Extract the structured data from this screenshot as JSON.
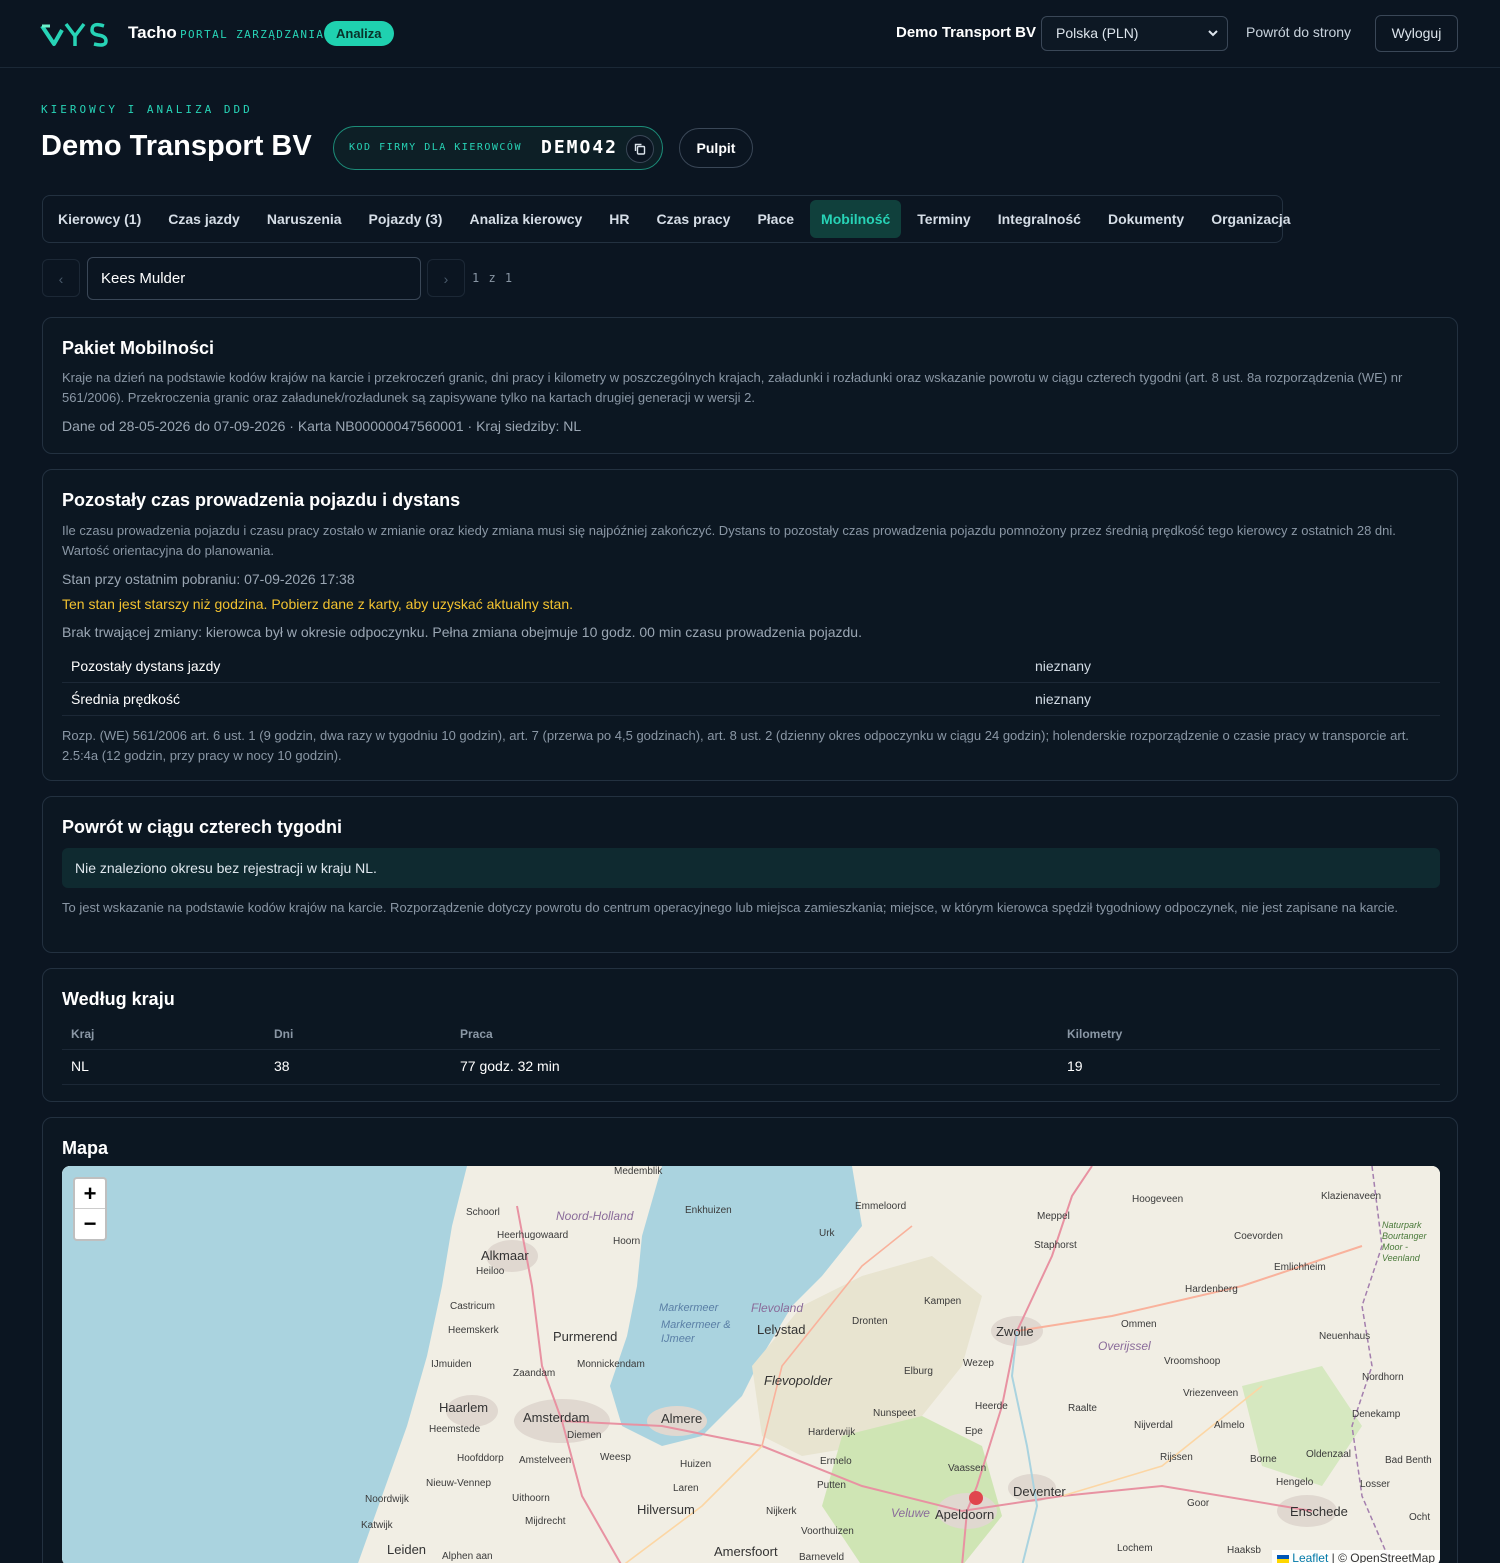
{
  "header": {
    "logo_text": "Tacho",
    "logo_sub": "PORTAL ZARZĄDZANIA",
    "badge": "Analiza",
    "company": "Demo Transport BV",
    "currency": "Polska (PLN)",
    "back_link": "Powrót do strony",
    "logout": "Wyloguj"
  },
  "page": {
    "eyebrow": "KIEROWCY I ANALIZA DDD",
    "title": "Demo Transport BV",
    "code_label": "KOD FIRMY DLA KIEROWCÓW",
    "code_value": "DEMO42",
    "pulpit": "Pulpit"
  },
  "tabs": [
    {
      "label": "Kierowcy (1)",
      "active": false
    },
    {
      "label": "Czas jazdy",
      "active": false
    },
    {
      "label": "Naruszenia",
      "active": false
    },
    {
      "label": "Pojazdy (3)",
      "active": false
    },
    {
      "label": "Analiza kierowcy",
      "active": false
    },
    {
      "label": "HR",
      "active": false
    },
    {
      "label": "Czas pracy",
      "active": false
    },
    {
      "label": "Płace",
      "active": false
    },
    {
      "label": "Mobilność",
      "active": true
    },
    {
      "label": "Terminy",
      "active": false
    },
    {
      "label": "Integralność",
      "active": false
    },
    {
      "label": "Dokumenty",
      "active": false
    },
    {
      "label": "Organizacja",
      "active": false
    }
  ],
  "driver": {
    "prev": "‹",
    "next": "›",
    "name": "Kees Mulder",
    "count": "1 z 1"
  },
  "pakiet": {
    "title": "Pakiet Mobilności",
    "desc": "Kraje na dzień na podstawie kodów krajów na karcie i przekroczeń granic, dni pracy i kilometry w poszczególnych krajach, załadunki i rozładunki oraz wskazanie powrotu w ciągu czterech tygodni (art. 8 ust. 8a rozporządzenia (WE) nr 561/2006). Przekroczenia granic oraz załadunek/rozładunek są zapisywane tylko na kartach drugiej generacji w wersji 2.",
    "meta": "Dane od 28-05-2026 do 07-09-2026 · Karta NB00000047560001 · Kraj siedziby: NL"
  },
  "remaining": {
    "title": "Pozostały czas prowadzenia pojazdu i dystans",
    "desc": "Ile czasu prowadzenia pojazdu i czasu pracy zostało w zmianie oraz kiedy zmiana musi się najpóźniej zakończyć. Dystans to pozostały czas prowadzenia pojazdu pomnożony przez średnią prędkość tego kierowcy z ostatnich 28 dni. Wartość orientacyjna do planowania.",
    "state": "Stan przy ostatnim pobraniu: 07-09-2026 17:38",
    "warning": "Ten stan jest starszy niż godzina. Pobierz dane z karty, aby uzyskać aktualny stan.",
    "no_shift": "Brak trwającej zmiany: kierowca był w okresie odpoczynku. Pełna zmiana obejmuje 10 godz. 00 min czasu prowadzenia pojazdu.",
    "rows": [
      {
        "label": "Pozostały dystans jazdy",
        "value": "nieznany"
      },
      {
        "label": "Średnia prędkość",
        "value": "nieznany"
      }
    ],
    "legal": "Rozp. (WE) 561/2006 art. 6 ust. 1 (9 godzin, dwa razy w tygodniu 10 godzin), art. 7 (przerwa po 4,5 godzinach), art. 8 ust. 2 (dzienny okres odpoczynku w ciągu 24 godzin); holenderskie rozporządzenie o czasie pracy w transporcie art. 2.5:4a (12 godzin, przy pracy w nocy 10 godzin)."
  },
  "return": {
    "title": "Powrót w ciągu czterech tygodni",
    "info": "Nie znaleziono okresu bez rejestracji w kraju NL.",
    "note": "To jest wskazanie na podstawie kodów krajów na karcie. Rozporządzenie dotyczy powrotu do centrum operacyjnego lub miejsca zamieszkania; miejsce, w którym kierowca spędził tygodniowy odpoczynek, nie jest zapisane na karcie."
  },
  "country": {
    "title": "Według kraju",
    "headers": [
      "Kraj",
      "Dni",
      "Praca",
      "Kilometry"
    ],
    "rows": [
      {
        "kraj": "NL",
        "dni": "38",
        "praca": "77 godz. 32 min",
        "km": "19"
      }
    ]
  },
  "map": {
    "title": "Mapa",
    "zoom_in": "+",
    "zoom_out": "−",
    "attribution_leaflet": "Leaflet",
    "attribution_rest": "| © OpenStreetMap",
    "labels": {
      "medemblik": "Medemblik",
      "schoorl": "Schoorl",
      "noord_holland": "Noord-Holland",
      "enkhuizen": "Enkhuizen",
      "heerhugowaard": "Heerhugowaard",
      "hoorn": "Hoorn",
      "alkmaar": "Alkmaar",
      "heiloo": "Heiloo",
      "castricum": "Castricum",
      "heemskerk": "Heemskerk",
      "purmerend": "Purmerend",
      "ijmuiden": "IJmuiden",
      "zaandam": "Zaandam",
      "monnickendam": "Monnickendam",
      "haarlem": "Haarlem",
      "heemstede": "Heemstede",
      "amsterdam": "Amsterdam",
      "diemen": "Diemen",
      "almere": "Almere",
      "hoofddorp": "Hoofddorp",
      "amstelveen": "Amstelveen",
      "weesp": "Weesp",
      "huizen": "Huizen",
      "laren": "Laren",
      "nieuw_vennep": "Nieuw-Vennep",
      "uithoorn": "Uithoorn",
      "hilversum": "Hilversum",
      "noordwijk": "Noordwijk",
      "katwijk": "Katwijk",
      "mijdrecht": "Mijdrecht",
      "leiden": "Leiden",
      "alphen": "Alphen aan",
      "markermeer": "Markermeer",
      "markermeer_ijmeer": "Markermeer & IJmeer",
      "flevoland": "Flevoland",
      "lelystad": "Lelystad",
      "flevopolder": "Flevopolder",
      "urk": "Urk",
      "emmeloord": "Emmeloord",
      "dronten": "Dronten",
      "kampen": "Kampen",
      "elburg": "Elburg",
      "zwolle": "Zwolle",
      "wezep": "Wezep",
      "nunspeet": "Nunspeet",
      "harderwijk": "Harderwijk",
      "ermelo": "Ermelo",
      "putten": "Putten",
      "nijkerk": "Nijkerk",
      "voorthuizen": "Voorthuizen",
      "amersfoort": "Amersfoort",
      "barneveld": "Barneveld",
      "heerde": "Heerde",
      "epe": "Epe",
      "vaassen": "Vaassen",
      "apeldoorn": "Apeldoorn",
      "veluwe": "Veluwe",
      "deventer": "Deventer",
      "meppel": "Meppel",
      "staphorst": "Staphorst",
      "hoogeveen": "Hoogeveen",
      "coevorden": "Coevorden",
      "emlichheim": "Emlichheim",
      "hardenberg": "Hardenberg",
      "ommen": "Ommen",
      "overijssel": "Overijssel",
      "vroomshoop": "Vroomshoop",
      "vriezenveen": "Vriezenveen",
      "raalte": "Raalte",
      "nijverdal": "Nijverdal",
      "almelo": "Almelo",
      "rijssen": "Rijssen",
      "borne": "Borne",
      "hengelo": "Hengelo",
      "oldenzaal": "Oldenzaal",
      "enschede": "Enschede",
      "goor": "Goor",
      "lochem": "Lochem",
      "haaksbergen": "Haaksb",
      "neuenhaus": "Neuenhaus",
      "nordhorn": "Nordhorn",
      "denekamp": "Denekamp",
      "bad_bentheim": "Bad Benth",
      "losser": "Losser",
      "ochtrup": "Ocht",
      "klazienaveen": "Klazienaveen",
      "naturpark": "Naturpark Bourtanger Moor - Veenland"
    }
  }
}
